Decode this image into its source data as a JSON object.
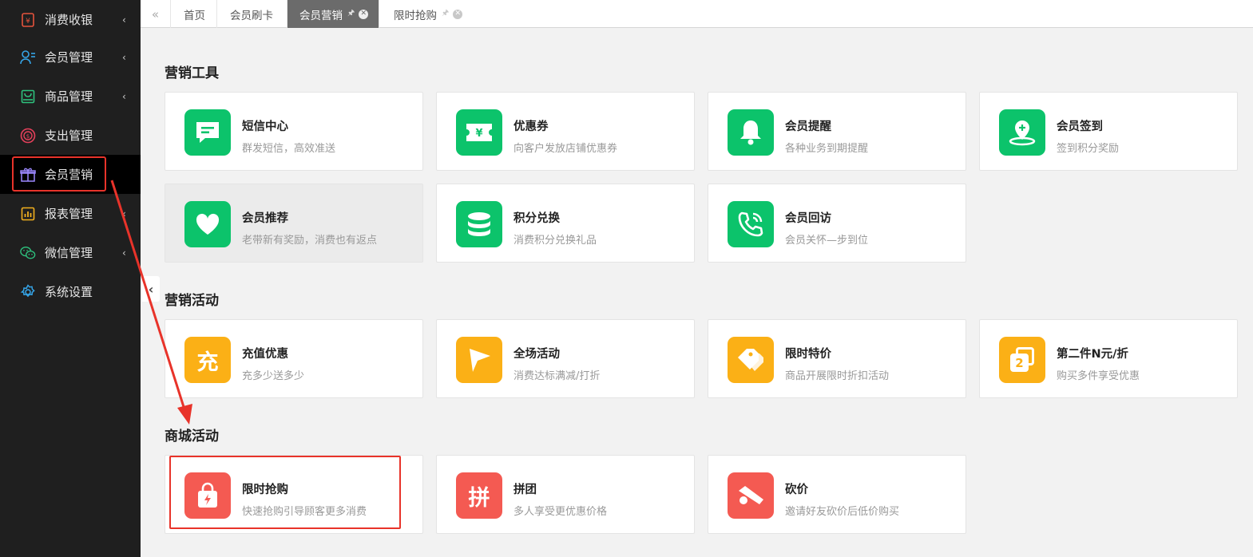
{
  "sidebar": {
    "items": [
      {
        "label": "消费收银",
        "icon": "cashier-icon",
        "color": "#e5533d",
        "has_children": true
      },
      {
        "label": "会员管理",
        "icon": "member-icon",
        "color": "#35a5e8",
        "has_children": true
      },
      {
        "label": "商品管理",
        "icon": "goods-icon",
        "color": "#2ec27e",
        "has_children": true
      },
      {
        "label": "支出管理",
        "icon": "expense-icon",
        "color": "#e5405b",
        "has_children": false
      },
      {
        "label": "会员营销",
        "icon": "gift-icon",
        "color": "#9c88ff",
        "has_children": false,
        "active": true
      },
      {
        "label": "报表管理",
        "icon": "report-icon",
        "color": "#f2b01e",
        "has_children": true
      },
      {
        "label": "微信管理",
        "icon": "wechat-icon",
        "color": "#2ec27e",
        "has_children": true
      },
      {
        "label": "系统设置",
        "icon": "settings-icon",
        "color": "#35a5e8",
        "has_children": false
      }
    ],
    "chevron": "‹"
  },
  "tabs": [
    {
      "label": "首页",
      "active": false
    },
    {
      "label": "会员刷卡",
      "active": false
    },
    {
      "label": "会员营销",
      "active": true,
      "pinned": true,
      "closable": true
    },
    {
      "label": "限时抢购",
      "active": false,
      "pinned": true,
      "closable": true
    }
  ],
  "sections": [
    {
      "title": "营销工具",
      "cards": [
        {
          "title": "短信中心",
          "desc": "群发短信，高效准送",
          "icon": "sms-icon",
          "color": "green"
        },
        {
          "title": "优惠券",
          "desc": "向客户发放店铺优惠券",
          "icon": "coupon-icon",
          "color": "green"
        },
        {
          "title": "会员提醒",
          "desc": "各种业务到期提醒",
          "icon": "bell-icon",
          "color": "green"
        },
        {
          "title": "会员签到",
          "desc": "签到积分奖励",
          "icon": "checkin-icon",
          "color": "green"
        },
        {
          "title": "会员推荐",
          "desc": "老带新有奖励，消费也有返点",
          "icon": "heart-icon",
          "color": "green",
          "hover": true
        },
        {
          "title": "积分兑换",
          "desc": "消费积分兑换礼品",
          "icon": "coins-icon",
          "color": "green"
        },
        {
          "title": "会员回访",
          "desc": "会员关怀—步到位",
          "icon": "phone-icon",
          "color": "green"
        }
      ]
    },
    {
      "title": "营销活动",
      "cards": [
        {
          "title": "充值优惠",
          "desc": "充多少送多少",
          "icon": "recharge-icon",
          "glyph": "充",
          "color": "orange"
        },
        {
          "title": "全场活动",
          "desc": "消费达标满减/打折",
          "icon": "flag-icon",
          "color": "orange"
        },
        {
          "title": "限时特价",
          "desc": "商品开展限时折扣活动",
          "icon": "price-tag-icon",
          "color": "orange"
        },
        {
          "title": "第二件N元/折",
          "desc": "购买多件享受优惠",
          "icon": "second-item-icon",
          "glyph": "2",
          "color": "orange"
        }
      ]
    },
    {
      "title": "商城活动",
      "cards": [
        {
          "title": "限时抢购",
          "desc": "快速抢购引导顾客更多消费",
          "icon": "flash-bag-icon",
          "color": "red"
        },
        {
          "title": "拼团",
          "desc": "多人享受更优惠价格",
          "icon": "group-buy-icon",
          "glyph": "拼",
          "color": "red"
        },
        {
          "title": "砍价",
          "desc": "邀请好友砍价后低价购买",
          "icon": "bargain-icon",
          "color": "red"
        }
      ]
    }
  ],
  "colors": {
    "green": "#0cc36b",
    "orange": "#fbb016",
    "red": "#f45a52",
    "annotation": "#e8332a"
  }
}
